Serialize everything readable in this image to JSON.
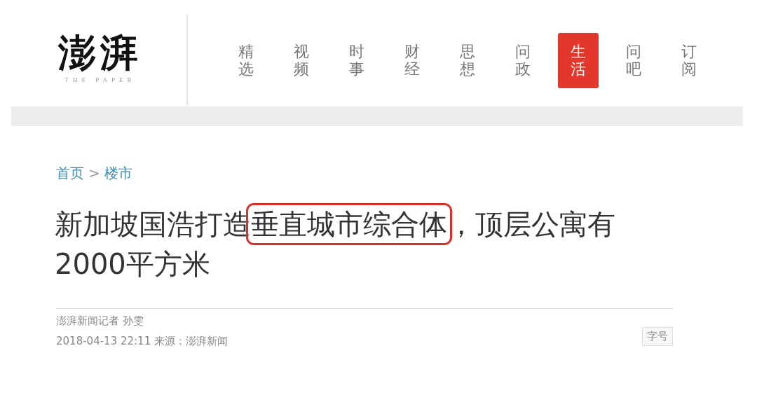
{
  "logo": {
    "name": "澎湃",
    "tagline": "THE PAPER"
  },
  "nav": [
    {
      "label": "精选",
      "selected": false
    },
    {
      "label": "视频",
      "selected": false
    },
    {
      "label": "时事",
      "selected": false
    },
    {
      "label": "财经",
      "selected": false
    },
    {
      "label": "思想",
      "selected": false
    },
    {
      "label": "问政",
      "selected": false
    },
    {
      "label": "生活",
      "selected": true
    },
    {
      "label": "问吧",
      "selected": false
    },
    {
      "label": "订阅",
      "selected": false
    }
  ],
  "breadcrumb": {
    "items": [
      "首页",
      "楼市"
    ],
    "separator": ">"
  },
  "article": {
    "title_parts": [
      {
        "text": "新加坡国浩打造",
        "highlighted": false
      },
      {
        "text": "垂直城市综合体",
        "highlighted": true
      },
      {
        "text": "，顶层公寓有2000平方米",
        "highlighted": false
      }
    ],
    "byline": "澎湃新闻记者 孙雯",
    "meta": "2018-04-13 22:11 来源：澎湃新闻",
    "font_size_button": "字号"
  }
}
